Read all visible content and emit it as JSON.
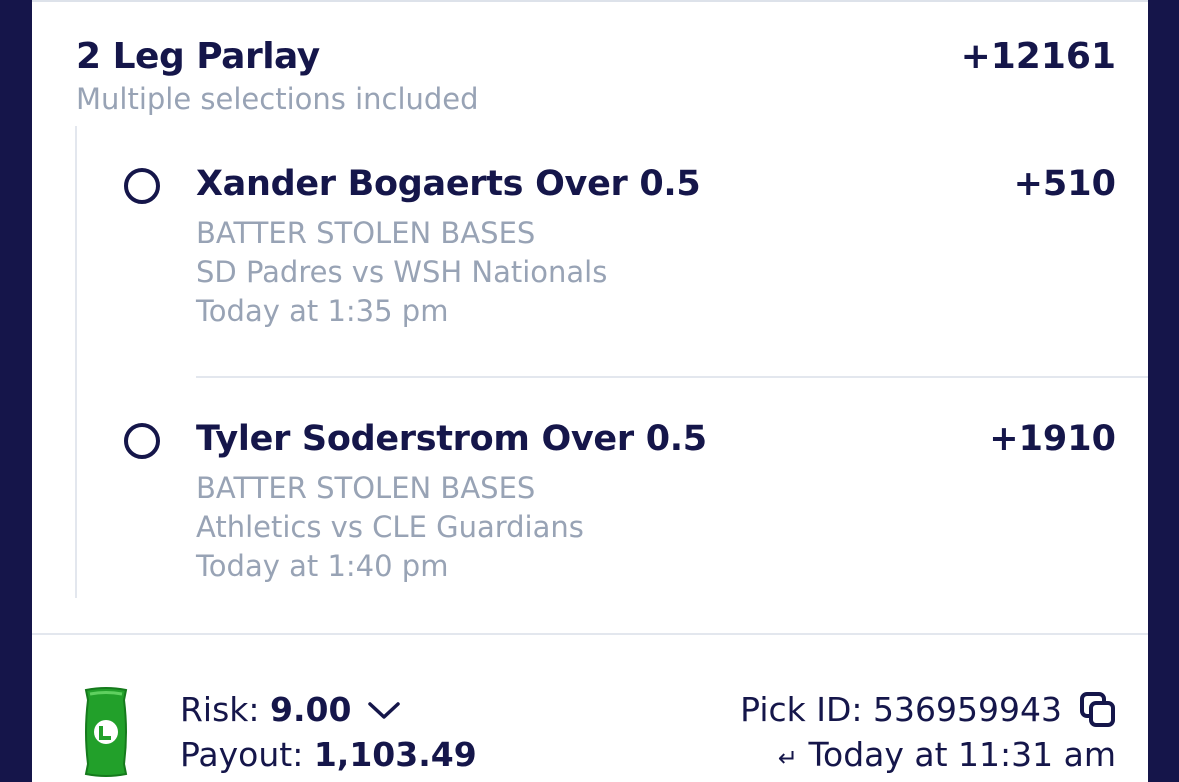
{
  "parlay": {
    "title": "2 Leg Parlay",
    "subtitle": "Multiple selections included",
    "odds": "+12161"
  },
  "legs": [
    {
      "selection": "Xander Bogaerts Over 0.5",
      "odds": "+510",
      "market": "BATTER STOLEN BASES",
      "matchup": "SD Padres vs WSH Nationals",
      "time": "Today at 1:35 pm"
    },
    {
      "selection": "Tyler Soderstrom Over 0.5",
      "odds": "+1910",
      "market": "BATTER STOLEN BASES",
      "matchup": "Athletics vs CLE Guardians",
      "time": "Today at 1:40 pm"
    }
  ],
  "footer": {
    "risk_label": "Risk:",
    "risk_value": "9.00",
    "payout_label": "Payout:",
    "payout_value": "1,103.49",
    "pick_id_label": "Pick ID:",
    "pick_id": "536959943",
    "placed_time": "Today at 11:31 am"
  },
  "icons": {
    "leg_status": "radio-circle-icon",
    "cash": "cash-icon",
    "risk_toggle": "chevron-down-icon",
    "copy": "copy-icon",
    "placed": "return-arrow-icon"
  },
  "colors": {
    "background": "#15154a",
    "text_primary": "#15164a",
    "text_muted": "#98a3b5",
    "divider": "#e3e7ee",
    "cash_green": "#22a02a"
  }
}
